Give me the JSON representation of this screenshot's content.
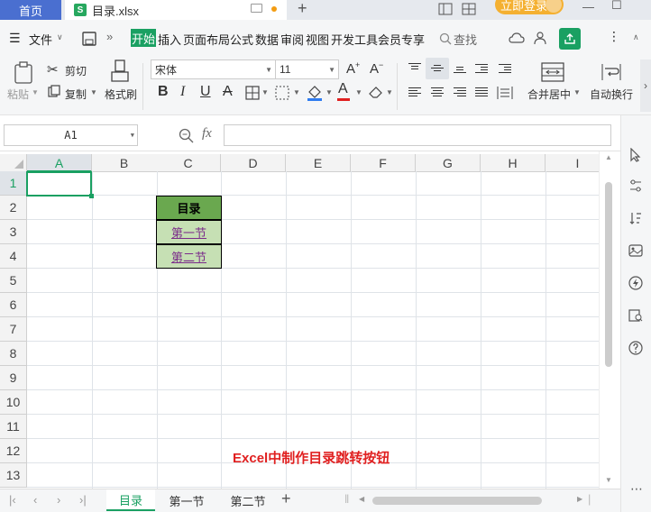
{
  "titlebar": {
    "home_tab": "首页",
    "file_tab": "目录.xlsx",
    "file_logo": "S",
    "new_tab": "+",
    "login": "立即登录",
    "min_icon": "—",
    "max_icon": "☐"
  },
  "menu": {
    "file": "文件",
    "items": [
      "开始",
      "插入",
      "页面布局",
      "公式",
      "数据",
      "审阅",
      "视图",
      "开发工具",
      "会员专享"
    ],
    "search": "查找"
  },
  "ribbon": {
    "paste": "粘贴",
    "cut": "剪切",
    "copy": "复制",
    "format_painter": "格式刷",
    "font_name": "宋体",
    "font_size": "11",
    "merge_center": "合并居中",
    "wrap_text": "自动换行"
  },
  "formula_bar": {
    "cell_ref": "A1",
    "fx": "fx",
    "value": ""
  },
  "grid": {
    "columns": [
      "A",
      "B",
      "C",
      "D",
      "E",
      "F",
      "G",
      "H",
      "I"
    ],
    "rows": [
      "1",
      "2",
      "3",
      "4",
      "5",
      "6",
      "7",
      "8",
      "9",
      "10",
      "11",
      "12",
      "13"
    ],
    "toc_header": "目录",
    "toc_link_1": "第一节",
    "toc_link_2": "第二节",
    "banner": "Excel中制作目录跳转按钮"
  },
  "sheets": {
    "tabs": [
      "目录",
      "第一节",
      "第二节"
    ],
    "add": "+"
  },
  "colors": {
    "accent": "#1aa062",
    "header_green": "#6aa84f",
    "link_green": "#c6e0b4",
    "banner_red": "#e02020",
    "home_blue": "#4a6fd0",
    "login_orange": "#f4b031"
  }
}
